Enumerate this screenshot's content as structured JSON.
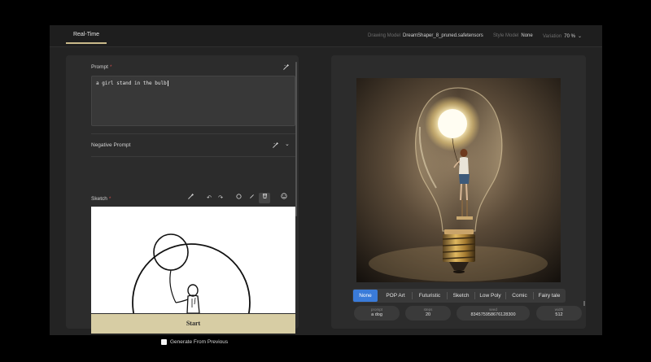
{
  "header": {
    "tab_realtime": "Real-Time",
    "drawing_model_label": "Drawing Model",
    "drawing_model_value": "DreamShaper_8_pruned.safetensors",
    "style_model_label": "Style Model",
    "style_model_value": "None",
    "variation_label": "Variation",
    "variation_value": "70 %"
  },
  "left": {
    "prompt_label": "Prompt",
    "required_mark": "*",
    "prompt_value": "a girl stand in the bulb",
    "negative_prompt_label": "Negative Prompt",
    "sketch_label": "Sketch",
    "start_label": "Start",
    "generate_from_previous_label": "Generate From Previous"
  },
  "right": {
    "styles": [
      "None",
      "POP Art",
      "Futuristic",
      "Sketch",
      "Low Poly",
      "Comic",
      "Fairy tale"
    ],
    "selected_style": "None",
    "params": [
      {
        "label": "prompt",
        "value": "a dog"
      },
      {
        "label": "steps",
        "value": "20"
      },
      {
        "label": "seed",
        "value": "834575958676128300"
      },
      {
        "label": "width",
        "value": "512"
      }
    ]
  },
  "colors": {
    "accent_gold": "#c9b98a",
    "start_button": "#d7cda4",
    "selected_style": "#3a7bd9",
    "required": "#c94a4a",
    "panel": "#2c2c2c",
    "window": "#232323"
  },
  "icons": {
    "prompt_tool": "magic-brush-icon",
    "negative_toggle": "chevron-down-icon",
    "sketch_tools": [
      "brush-icon",
      "undo-icon",
      "redo-icon",
      "circle-icon",
      "line-icon",
      "bucket-icon",
      "reset-icon"
    ],
    "variation_dropdown": "chevron-down-icon"
  }
}
